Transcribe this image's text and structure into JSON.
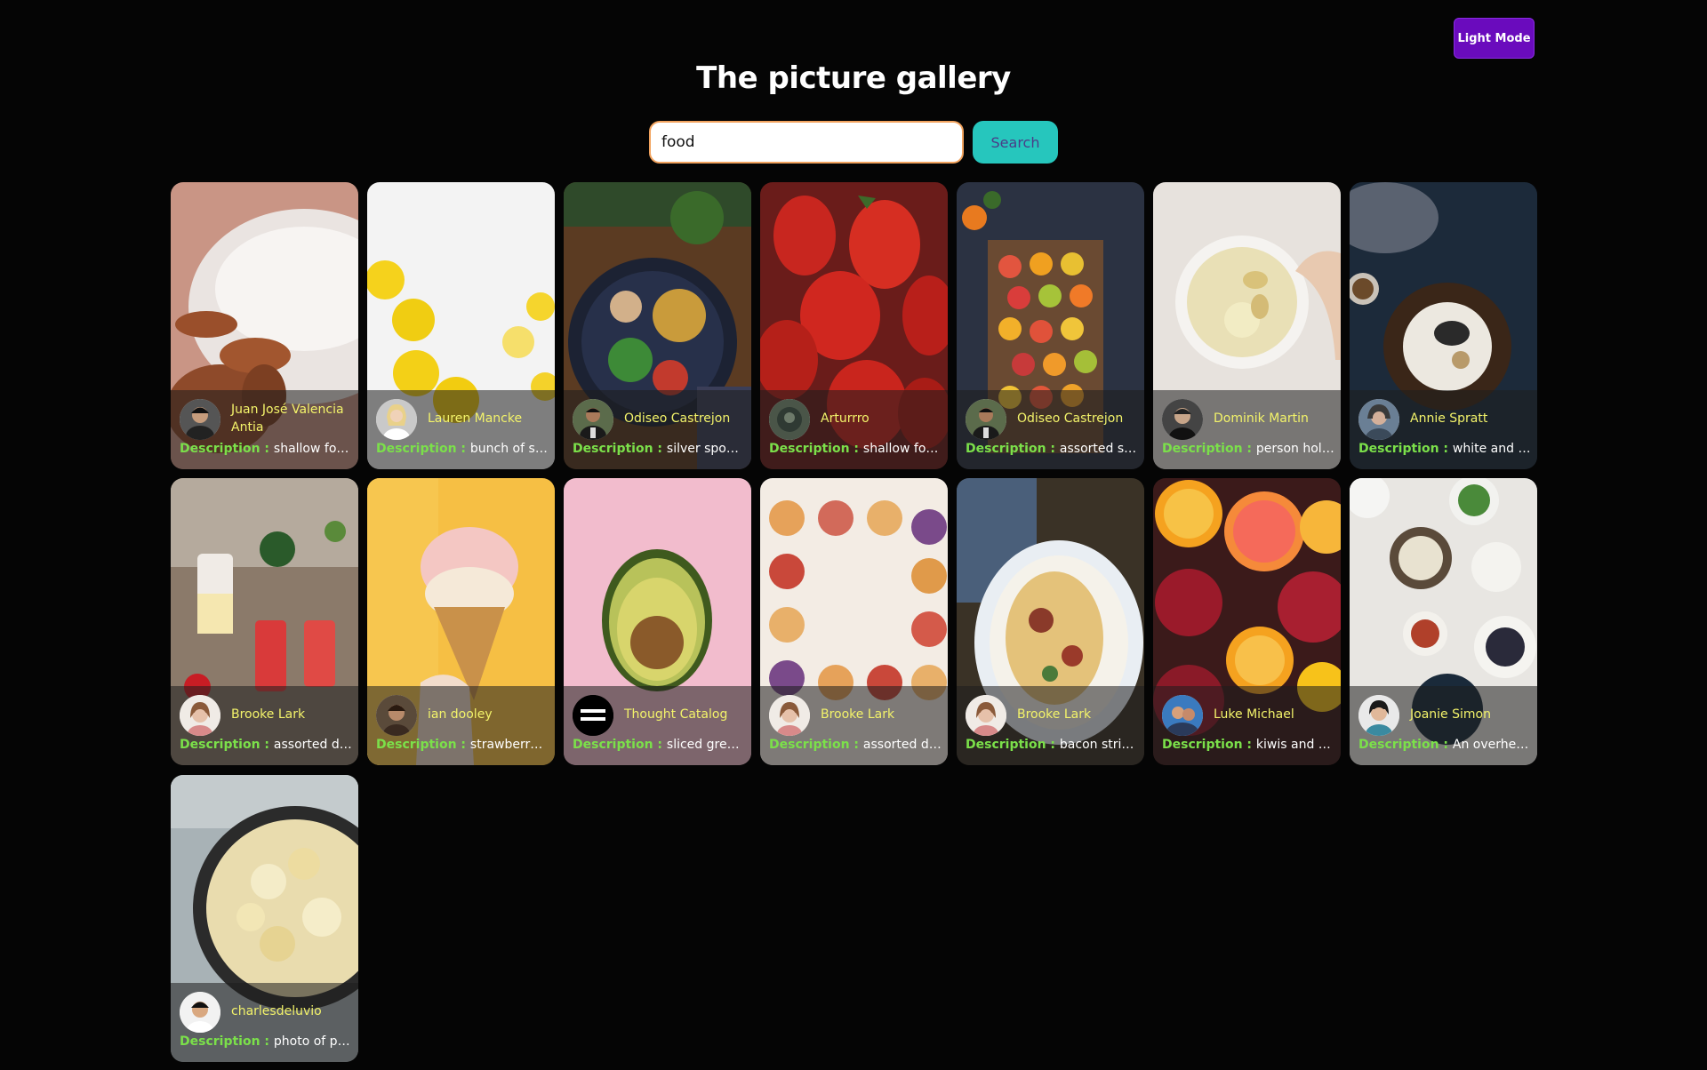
{
  "mode_button": "Light Mode",
  "title": "The picture gallery",
  "search": {
    "value": "food",
    "button": "Search"
  },
  "description_label": "Description : ",
  "cards": [
    {
      "author": "Juan José Valencia Antia",
      "description": "shallow focus..."
    },
    {
      "author": "Lauren Mancke",
      "description": "bunch of slice..."
    },
    {
      "author": "Odiseo Castrejon",
      "description": "silver spoon o..."
    },
    {
      "author": "Arturrro",
      "description": "shallow focus..."
    },
    {
      "author": "Odiseo Castrejon",
      "description": "assorted slice..."
    },
    {
      "author": "Dominik Martin",
      "description": "person holdin..."
    },
    {
      "author": "Annie Spratt",
      "description": "white and bro..."
    },
    {
      "author": "Brooke Lark",
      "description": "assorted drin..."
    },
    {
      "author": "ian dooley",
      "description": "strawberry ic..."
    },
    {
      "author": "Thought Catalog",
      "description": "sliced green ..."
    },
    {
      "author": "Brooke Lark",
      "description": "assorted don..."
    },
    {
      "author": "Brooke Lark",
      "description": "bacon strips ..."
    },
    {
      "author": "Luke Michael",
      "description": "kiwis and ora..."
    },
    {
      "author": "Joanie Simon",
      "description": "An overhead ..."
    },
    {
      "author": "charlesdeluvio",
      "description": "photo of pop..."
    }
  ],
  "colors": {
    "background": "#050505",
    "mode_button": "#6a0bbd",
    "search_button": "#26c6bd",
    "author_text": "#f3f36a",
    "description_label": "#7be04a",
    "search_border": "#f2a35e"
  }
}
